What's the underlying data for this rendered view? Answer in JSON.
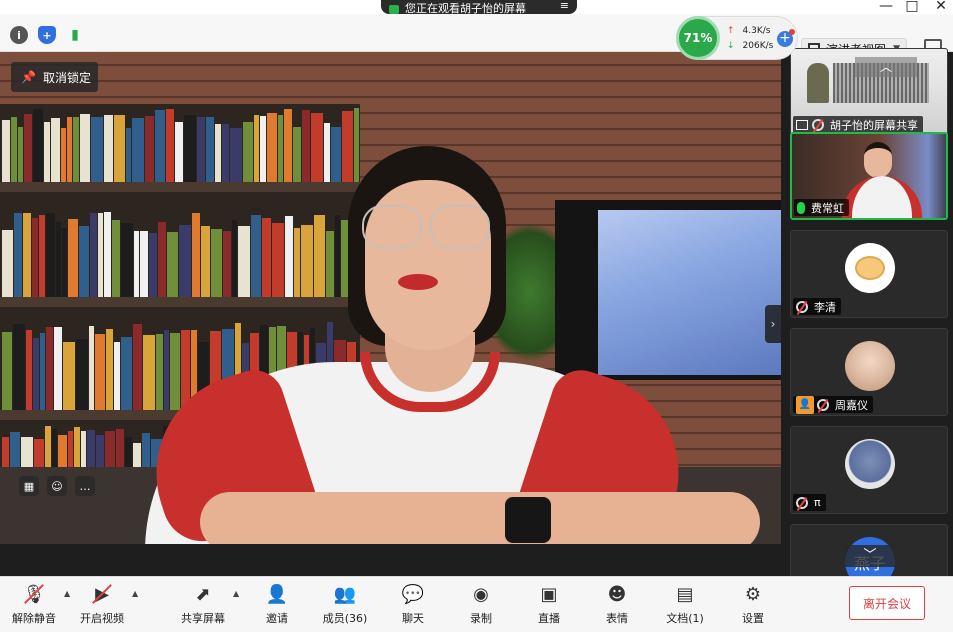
{
  "title_bar": {
    "share_notice": "您正在观看胡子怡的屏幕",
    "window_controls": [
      "—",
      "□",
      "✕"
    ]
  },
  "top_bar": {
    "network": {
      "quality_percent": "71%",
      "upload": "4.3K/s",
      "download": "206K/s"
    },
    "view_mode_label": "演讲者视图",
    "colors": {
      "good": "#2aa84a",
      "accent": "#3a7be0"
    }
  },
  "main_video": {
    "unlock_label": "取消锁定"
  },
  "sidebar": {
    "tiles": [
      {
        "name": "胡子怡的屏幕共享",
        "type": "screen-share"
      },
      {
        "name": "费常虹",
        "type": "camera",
        "mic": "on",
        "active": true
      },
      {
        "name": "李清",
        "type": "avatar",
        "mic": "off"
      },
      {
        "name": "周嘉仪",
        "type": "avatar",
        "mic": "off",
        "host": true
      },
      {
        "name": "π",
        "type": "avatar",
        "mic": "off"
      },
      {
        "name": "燕子",
        "type": "avatar",
        "mic": "off"
      }
    ]
  },
  "bottom_bar": {
    "buttons": [
      {
        "id": "unmute",
        "label": "解除静音",
        "icon": "mic-off-icon"
      },
      {
        "id": "start-video",
        "label": "开启视频",
        "icon": "camera-off-icon"
      },
      {
        "id": "share-screen",
        "label": "共享屏幕",
        "icon": "share-screen-icon"
      },
      {
        "id": "invite",
        "label": "邀请",
        "icon": "add-person-icon"
      },
      {
        "id": "members",
        "label": "成员(36)",
        "icon": "people-icon"
      },
      {
        "id": "chat",
        "label": "聊天",
        "icon": "chat-icon"
      },
      {
        "id": "record",
        "label": "录制",
        "icon": "record-icon"
      },
      {
        "id": "live",
        "label": "直播",
        "icon": "live-icon"
      },
      {
        "id": "reactions",
        "label": "表情",
        "icon": "smile-icon"
      },
      {
        "id": "docs",
        "label": "文档(1)",
        "icon": "document-icon"
      },
      {
        "id": "settings",
        "label": "设置",
        "icon": "gear-icon"
      }
    ],
    "leave_label": "离开会议",
    "leave_color": "#e34040"
  }
}
